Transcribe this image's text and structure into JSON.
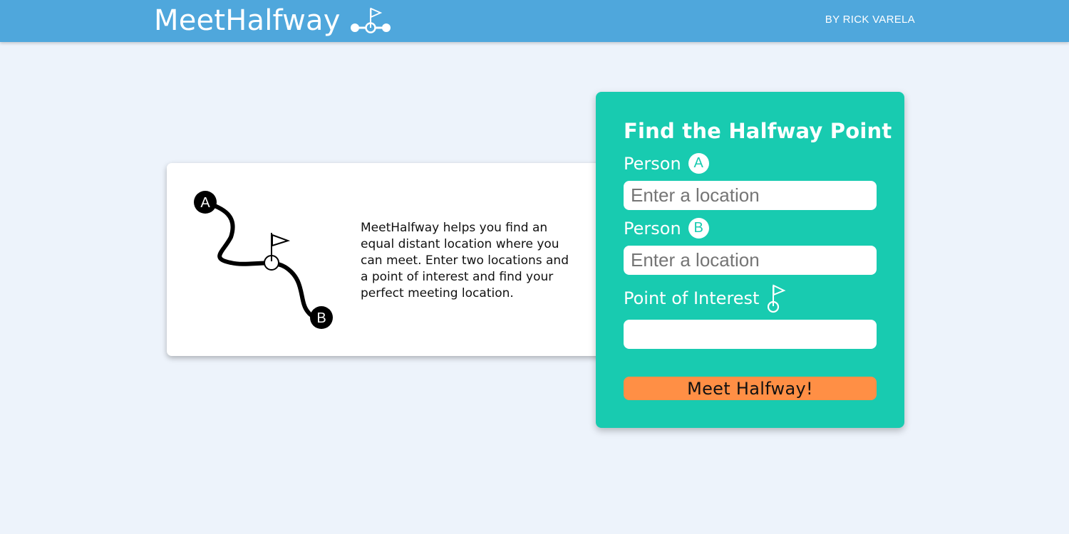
{
  "header": {
    "brand_title": "MeetHalfway",
    "brand_icon": "route-flag-logo-icon",
    "byline": "BY RICK VARELA",
    "background_color": "#4fa7dc"
  },
  "intro": {
    "illustration_icon": "route-a-to-b-icon",
    "point_a_label": "A",
    "point_b_label": "B",
    "description": "MeetHalfway helps you find an equal distant location where you can meet. Enter two locations and a point of interest and find your perfect meeting location."
  },
  "form": {
    "title": "Find the Halfway Point",
    "person_a": {
      "label": "Person",
      "badge": "A",
      "value": "",
      "placeholder": "Enter a location"
    },
    "person_b": {
      "label": "Person",
      "badge": "B",
      "value": "",
      "placeholder": "Enter a location"
    },
    "point_of_interest": {
      "label": "Point of Interest",
      "icon": "flag-pin-icon",
      "value": "",
      "placeholder": ""
    },
    "submit_label": "Meet Halfway!",
    "card_color": "#18cbb0",
    "button_color": "#ff8f45"
  }
}
